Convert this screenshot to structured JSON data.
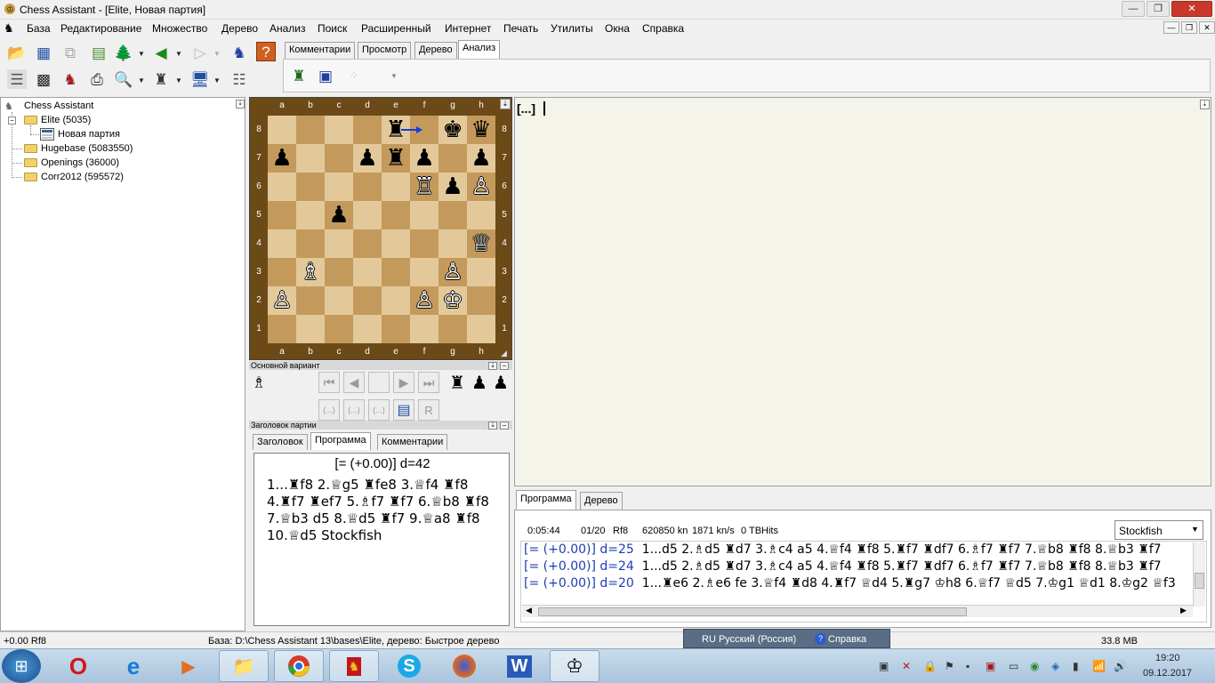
{
  "window": {
    "title": "Chess Assistant - [Elite, Новая партия]"
  },
  "menu": [
    "База",
    "Редактирование",
    "Множество",
    "Дерево",
    "Анализ",
    "Поиск",
    "Расширенный",
    "Интернет",
    "Печать",
    "Утилиты",
    "Окна",
    "Справка"
  ],
  "analysis_tabs": [
    "Комментарии",
    "Просмотр",
    "Дерево",
    "Анализ"
  ],
  "analysis_active_tab": "Анализ",
  "tree": {
    "root": "Chess Assistant",
    "items": [
      {
        "label": "Elite (5035)"
      },
      {
        "label": "Новая партия"
      },
      {
        "label": "Hugebase (5083550)"
      },
      {
        "label": "Openings (36000)"
      },
      {
        "label": "Corr2012 (595572)"
      }
    ]
  },
  "board": {
    "files": [
      "a",
      "b",
      "c",
      "d",
      "e",
      "f",
      "g",
      "h"
    ],
    "ranks": [
      "8",
      "7",
      "6",
      "5",
      "4",
      "3",
      "2",
      "1"
    ],
    "pieces": [
      {
        "sq": "e8",
        "p": "♜",
        "c": "b"
      },
      {
        "sq": "g8",
        "p": "♚",
        "c": "b"
      },
      {
        "sq": "h8",
        "p": "♛",
        "c": "b"
      },
      {
        "sq": "a7",
        "p": "♟",
        "c": "b"
      },
      {
        "sq": "d7",
        "p": "♟",
        "c": "b"
      },
      {
        "sq": "e7",
        "p": "♜",
        "c": "b"
      },
      {
        "sq": "f7",
        "p": "♟",
        "c": "b"
      },
      {
        "sq": "h7",
        "p": "♟",
        "c": "b"
      },
      {
        "sq": "f6",
        "p": "♖",
        "c": "w"
      },
      {
        "sq": "g6",
        "p": "♟",
        "c": "b"
      },
      {
        "sq": "h6",
        "p": "♙",
        "c": "w"
      },
      {
        "sq": "c5",
        "p": "♟",
        "c": "b"
      },
      {
        "sq": "h4",
        "p": "♕",
        "c": "w"
      },
      {
        "sq": "b3",
        "p": "♗",
        "c": "w"
      },
      {
        "sq": "g3",
        "p": "♙",
        "c": "w"
      },
      {
        "sq": "a2",
        "p": "♙",
        "c": "w"
      },
      {
        "sq": "f2",
        "p": "♙",
        "c": "w"
      },
      {
        "sq": "g2",
        "p": "♔",
        "c": "w"
      }
    ],
    "arrow": {
      "from": "e8",
      "to": "f8"
    }
  },
  "mainline": {
    "header": "Основной вариант",
    "captured": [
      "♜",
      "♟",
      "♟"
    ]
  },
  "game_header": {
    "header": "Заголовок партии",
    "tabs": [
      "Заголовок",
      "Программа",
      "Комментарии"
    ],
    "active_tab": "Программа"
  },
  "program": {
    "eval": "[= (+0.00)] d=42",
    "lines": [
      "1...♜f8 2.♕g5 ♜fe8 3.♕f4 ♜f8",
      "4.♜f7 ♜ef7 5.♗f7 ♜f7 6.♕b8 ♜f8",
      "7.♕b3 d5 8.♕d5 ♜f7 9.♕a8 ♜f8",
      "10.♕d5 Stockfish"
    ]
  },
  "notation": {
    "text": "[...]"
  },
  "bottom_tabs": [
    "Программа",
    "Дерево"
  ],
  "bottom_active_tab": "Программа",
  "engine": {
    "time": "0:05:44",
    "move": "01/20",
    "current": "Rf8",
    "nodes": "620850 kn",
    "speed": "1871 kn/s",
    "tb": "0 TBHits",
    "name": "Stockfish",
    "lines": [
      {
        "eval": "[= (+0.00)] d=25",
        "moves": "1...d5 2.♗d5 ♜d7 3.♗c4 a5 4.♕f4 ♜f8 5.♜f7 ♜df7 6.♗f7 ♜f7 7.♕b8 ♜f8 8.♕b3 ♜f7"
      },
      {
        "eval": "[= (+0.00)] d=24",
        "moves": "1...d5 2.♗d5 ♜d7 3.♗c4 a5 4.♕f4 ♜f8 5.♜f7 ♜df7 6.♗f7 ♜f7 7.♕b8 ♜f8 8.♕b3 ♜f7"
      },
      {
        "eval": "[= (+0.00)] d=20",
        "moves": "1...♜e6 2.♗e6 fe 3.♕f4 ♜d8 4.♜f7 ♕d4 5.♜g7 ♔h8 6.♕f7 ♕d5 7.♔g1 ♕d1 8.♔g2 ♕f3"
      }
    ]
  },
  "status": {
    "left": "+0.00 Rf8",
    "base": "База: D:\\Chess Assistant 13\\bases\\Elite, дерево: Быстрое дерево",
    "lang": "RU Русский (Россия)",
    "help": "Справка",
    "mem": "33.8 MB"
  },
  "taskbar": {
    "time": "19:20",
    "date": "09.12.2017"
  }
}
